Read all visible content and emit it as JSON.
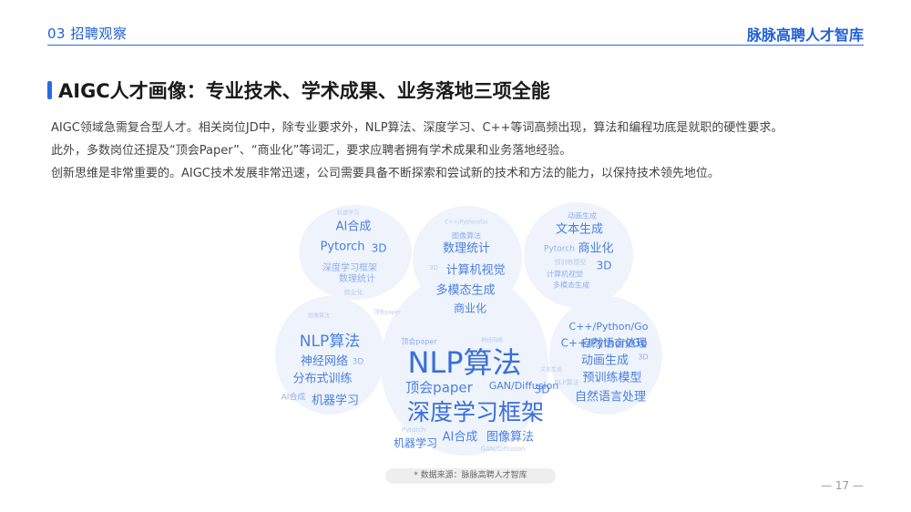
{
  "header": {
    "section": "03 招聘观察",
    "brand": "脉脉高聘人才智库"
  },
  "title": "AIGC人才画像：专业技术、学术成果、业务落地三项全能",
  "body_lines": [
    "AIGC领域急需复合型人才。相关岗位JD中，除专业要求外，NLP算法、深度学习、C++等词高频出现，算法和编程功底是就职的硬性要求。",
    "此外，多数岗位还提及“顶会Paper”、“商业化”等词汇，要求应聘者拥有学术成果和业务落地经验。",
    "创新思维是非常重要的。AIGC技术发展非常迅速，公司需要具备不断探索和尝试新的技术和方法的能力，以保持技术领先地位。"
  ],
  "word_cloud": {
    "colors": {
      "large": "#3a6fd8",
      "medium": "#4b7fe0",
      "small": "#8fb0ea",
      "tiny": "#b9cdef",
      "blob": "#eef3fc"
    },
    "words": [
      {
        "text": "AI合成",
        "size": 13
      },
      {
        "text": "Pytorch",
        "size": 13
      },
      {
        "text": "3D",
        "size": 12
      },
      {
        "text": "深度学习框架",
        "size": 10
      },
      {
        "text": "数理统计",
        "size": 10
      },
      {
        "text": "商业化",
        "size": 7
      },
      {
        "text": "机器学习",
        "size": 6
      },
      {
        "text": "图像算法",
        "size": 8
      },
      {
        "text": "数理统计",
        "size": 13
      },
      {
        "text": "计算机视觉",
        "size": 13
      },
      {
        "text": "多模态生成",
        "size": 13
      },
      {
        "text": "商业化",
        "size": 12
      },
      {
        "text": "3D",
        "size": 7
      },
      {
        "text": "C++/Python/Go",
        "size": 6
      },
      {
        "text": "文本生成",
        "size": 13
      },
      {
        "text": "Pytorch",
        "size": 9
      },
      {
        "text": "商业化",
        "size": 13
      },
      {
        "text": "3D",
        "size": 12
      },
      {
        "text": "预训练模型",
        "size": 7
      },
      {
        "text": "计算机视觉",
        "size": 8
      },
      {
        "text": "多模态生成",
        "size": 8
      },
      {
        "text": "动画生成",
        "size": 8
      },
      {
        "text": "C++/Python/Go",
        "size": 11
      },
      {
        "text": "NLP算法",
        "size": 17
      },
      {
        "text": "神经网络",
        "size": 13
      },
      {
        "text": "3D",
        "size": 9
      },
      {
        "text": "分布式训练",
        "size": 13
      },
      {
        "text": "AI合成",
        "size": 9
      },
      {
        "text": "机器学习",
        "size": 13
      },
      {
        "text": "图像算法",
        "size": 6
      },
      {
        "text": "顶会paper",
        "size": 6
      },
      {
        "text": "NLP算法",
        "size": 32
      },
      {
        "text": "顶会paper",
        "size": 15
      },
      {
        "text": "GAN/Diffusion",
        "size": 11
      },
      {
        "text": "3D",
        "size": 12
      },
      {
        "text": "深度学习框架",
        "size": 25
      },
      {
        "text": "AI合成",
        "size": 13
      },
      {
        "text": "图像算法",
        "size": 13
      },
      {
        "text": "机器学习",
        "size": 12
      },
      {
        "text": "Pytorch",
        "size": 7
      },
      {
        "text": "GAN/Diffusion",
        "size": 7
      },
      {
        "text": "顶会paper",
        "size": 8
      },
      {
        "text": "神经网络",
        "size": 6
      },
      {
        "text": "文本生成",
        "size": 6
      },
      {
        "text": "C++/Python/Go",
        "size": 12
      },
      {
        "text": "自然语言处理",
        "size": 12
      },
      {
        "text": "动画生成",
        "size": 13
      },
      {
        "text": "预训练模型",
        "size": 13
      },
      {
        "text": "自然语言处理",
        "size": 13
      },
      {
        "text": "NLP算法",
        "size": 7
      },
      {
        "text": "3D",
        "size": 8
      }
    ]
  },
  "source": "* 数据来源：脉脉高聘人才智库",
  "page_number": "— 17 —"
}
